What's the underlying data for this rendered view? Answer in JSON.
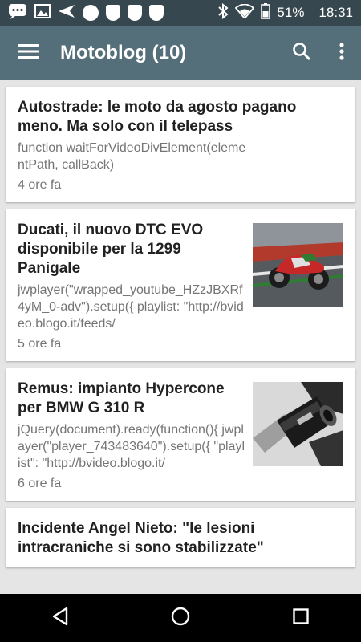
{
  "status_bar": {
    "battery": "51%",
    "time": "18:31",
    "left_icons": [
      "messaging-icon",
      "image-icon",
      "send-icon",
      "circle-icon",
      "notification-icon",
      "notification-icon",
      "notification-icon"
    ],
    "right_icons": [
      "bluetooth-icon",
      "wifi-icon",
      "battery-icon"
    ]
  },
  "app_bar": {
    "title": "Motoblog (10)",
    "color": "#546e7a",
    "status_color": "#37474f"
  },
  "articles": [
    {
      "title": "Autostrade: le moto da agosto pagano meno. Ma solo con il telepass",
      "snippet": "function waitForVideoDivElement(elementPath, callBack)",
      "time": "4 ore fa",
      "has_image": false
    },
    {
      "title": "Ducati, il nuovo DTC EVO disponibile per la 1299 Panigale",
      "snippet": "jwplayer(\"wrapped_youtube_HZzJBXRf4yM_0-adv\").setup({ playlist: \"http://bvideo.blogo.it/feeds/",
      "time": "5 ore fa",
      "has_image": true,
      "image": "ducati-motorcycle-photo"
    },
    {
      "title": "Remus: impianto Hypercone per BMW G 310 R",
      "snippet": "jQuery(document).ready(function(){ jwplayer(\"player_743483640\").setup({ \"playlist\": \"http://bvideo.blogo.it/",
      "time": "6 ore fa",
      "has_image": true,
      "image": "exhaust-pipe-photo"
    },
    {
      "title": "Incidente Angel Nieto: \"le lesioni intracraniche si sono stabilizzate\"",
      "snippet": "",
      "time": "",
      "has_image": false
    }
  ]
}
